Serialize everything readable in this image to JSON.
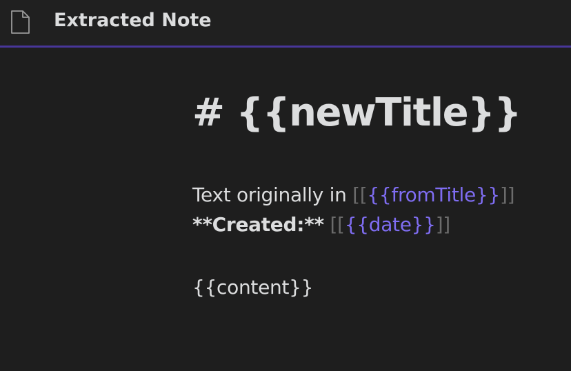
{
  "header": {
    "title": "Extracted Note",
    "icon": "file-icon"
  },
  "editor": {
    "heading": "# {{newTitle}}",
    "line1": {
      "text": "Text originally in ",
      "open_bracket": "[[",
      "link": "{{fromTitle}}",
      "close_bracket": "]]"
    },
    "line2": {
      "bold_text": "**Created:**",
      "space": " ",
      "open_bracket": "[[",
      "link": "{{date}}",
      "close_bracket": "]]"
    },
    "content": "{{content}}"
  },
  "colors": {
    "background": "#1e1e1e",
    "header_background": "#202020",
    "accent": "#483699",
    "text": "#dcddde",
    "link": "#7f6df2",
    "bracket": "#6b6b6b"
  }
}
